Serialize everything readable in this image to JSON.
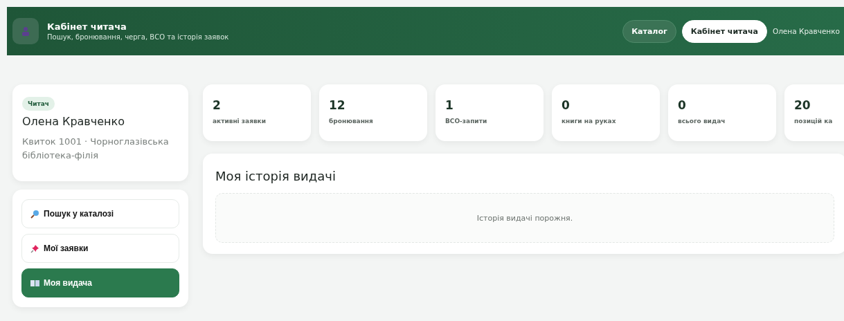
{
  "header": {
    "title": "Кабінет читача",
    "subtitle": "Пошук, бронювання, черга, ВСО та історія заявок",
    "nav": [
      {
        "label": "Каталог",
        "selected": false
      },
      {
        "label": "Кабінет читача",
        "selected": true
      }
    ],
    "user": "Олена Кравченко"
  },
  "profile": {
    "role": "Читач",
    "name": "Олена Кравченко",
    "details": "Квиток 1001 · Чорноглазівська бібліотека-філія"
  },
  "menu": [
    {
      "label": "Пошук у каталозі",
      "kind": "search",
      "selected": false
    },
    {
      "label": "Мої заявки",
      "kind": "pin",
      "selected": false
    },
    {
      "label": "Моя видача",
      "kind": "book",
      "selected": true
    }
  ],
  "stats": [
    {
      "value": "2",
      "label": "активні заявки"
    },
    {
      "value": "12",
      "label": "бронювання"
    },
    {
      "value": "1",
      "label": "ВСО-запити"
    },
    {
      "value": "0",
      "label": "книги на руках"
    },
    {
      "value": "0",
      "label": "всього видач"
    },
    {
      "value": "20",
      "label": "позицій ка"
    }
  ],
  "history": {
    "title": "Моя історія видачі",
    "empty": "Історія видачі порожня."
  }
}
